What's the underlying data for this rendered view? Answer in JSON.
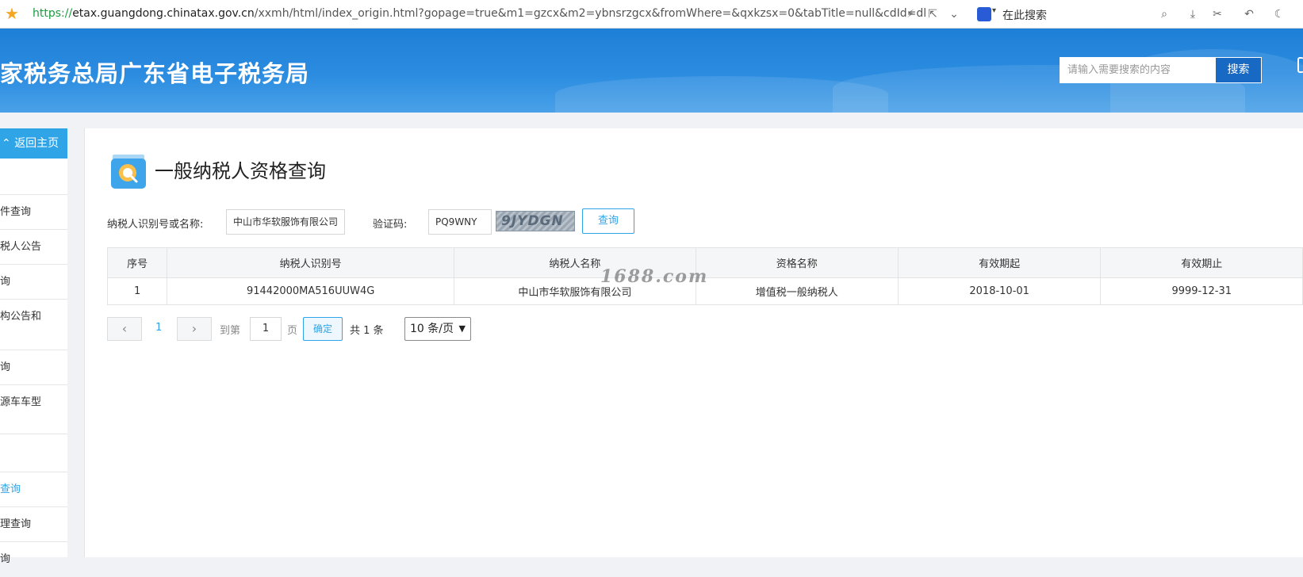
{
  "browser": {
    "url_proto": "https://",
    "url_host": "etax.guangdong.chinatax.gov.cn",
    "url_path": "/xxmh/html/index_origin.html?gopage=true&m1=gzcx&m2=ybnsrzgcx&fromWhere=&qxkzsx=0&tabTitle=null&cdId=dl",
    "search_label": "在此搜索",
    "icons": [
      "star-icon",
      "lightning-icon",
      "share-icon",
      "chevron-down-icon",
      "search-icon",
      "download-icon",
      "scissors-icon",
      "undo-icon",
      "moon-icon"
    ]
  },
  "header": {
    "title": "家税务总局广东省电子税务局",
    "search_placeholder": "请输入需要搜索的内容",
    "search_button": "搜索"
  },
  "sidebar": {
    "home_label": "返回主页",
    "items": [
      {
        "lines": [
          ""
        ]
      },
      {
        "lines": [
          "件查询"
        ]
      },
      {
        "lines": [
          "税人公告"
        ]
      },
      {
        "lines": [
          "询"
        ]
      },
      {
        "lines": [
          "构公告和",
          ""
        ]
      },
      {
        "lines": [
          "询"
        ]
      },
      {
        "lines": [
          "源车车型",
          ""
        ]
      },
      {
        "lines": [
          ""
        ]
      },
      {
        "lines": [
          "查询"
        ],
        "active": true
      },
      {
        "lines": [
          "理查询"
        ]
      },
      {
        "lines": [
          "询"
        ]
      }
    ]
  },
  "page": {
    "title": "一般纳税人资格查询",
    "taxpayer_label": "纳税人识别号或名称:",
    "taxpayer_value": "中山市华软服饰有限公司",
    "captcha_label": "验证码:",
    "captcha_value": "PQ9WNY",
    "captcha_image_text": "9JYDGN",
    "query_button": "查询"
  },
  "table": {
    "headers": [
      "序号",
      "纳税人识别号",
      "纳税人名称",
      "资格名称",
      "有效期起",
      "有效期止"
    ],
    "rows": [
      [
        "1",
        "91442000MA516UUW4G",
        "中山市华软服饰有限公司",
        "增值税一般纳税人",
        "2018-10-01",
        "9999-12-31"
      ]
    ]
  },
  "watermark": "1688.com",
  "pagination": {
    "current_page": "1",
    "goto_label": "到第",
    "goto_value": "1",
    "page_unit": "页",
    "confirm": "确定",
    "total": "共 1 条",
    "page_size": "10 条/页"
  },
  "colors": {
    "accent": "#2fa4e7",
    "banner": "#1e7fd6"
  }
}
